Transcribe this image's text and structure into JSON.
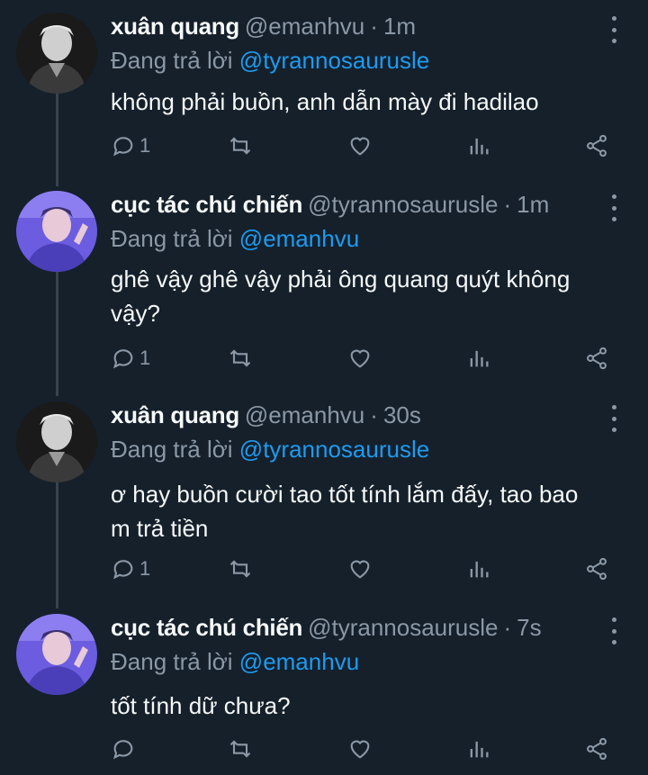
{
  "tweets": [
    {
      "name": "xuân quang",
      "handle": "@emanhvu",
      "time": "1m",
      "replying_prefix": "Đang trả lời",
      "replying_to": "@tyrannosaurusle",
      "text": "không phải buồn, anh dẫn mày đi hadilao",
      "reply_count": "1",
      "avatar": "dark-portrait"
    },
    {
      "name": "cục tác chú chiến",
      "handle": "@tyrannosaurusle",
      "time": "1m",
      "replying_prefix": "Đang trả lời",
      "replying_to": "@emanhvu",
      "text": "ghê vậy ghê vậy phải ông quang quýt không vậy?",
      "reply_count": "1",
      "avatar": "blue-portrait"
    },
    {
      "name": "xuân quang",
      "handle": "@emanhvu",
      "time": "30s",
      "replying_prefix": "Đang trả lời",
      "replying_to": "@tyrannosaurusle",
      "text": "ơ hay buồn cười tao tốt tính lắm đấy, tao bao m trả tiền",
      "reply_count": "1",
      "avatar": "dark-portrait"
    },
    {
      "name": "cục tác chú chiến",
      "handle": "@tyrannosaurusle",
      "time": "7s",
      "replying_prefix": "Đang trả lời",
      "replying_to": "@emanhvu",
      "text": "tốt tính dữ chưa?",
      "reply_count": "",
      "avatar": "blue-portrait"
    }
  ],
  "separator": "·",
  "icons": [
    "reply-icon",
    "retweet-icon",
    "like-icon",
    "views-icon",
    "share-icon",
    "more-icon"
  ],
  "colors": {
    "background": "#15202b",
    "text": "#f7f9f9",
    "muted": "#8b98a5",
    "link": "#1d9bf0",
    "thread_line": "#38444d"
  }
}
